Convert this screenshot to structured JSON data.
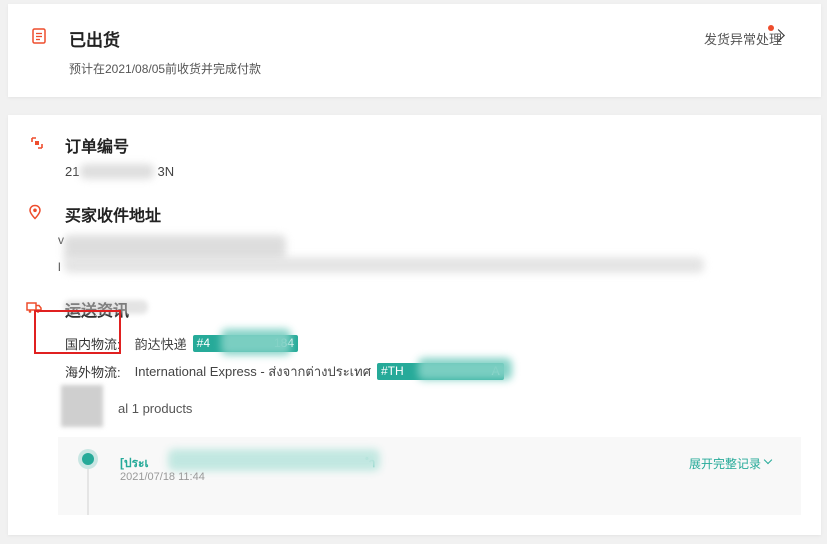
{
  "status": {
    "title": "已出货",
    "subtitle": "预计在2021/08/05前收货并完成付款",
    "exception_link": "发货异常处理",
    "icon": "document-icon"
  },
  "order": {
    "title": "订单编号",
    "number_prefix": "21",
    "number_suffix": "3N",
    "icon": "order-icon"
  },
  "address": {
    "title": "买家收件地址",
    "line1_prefix": "v",
    "line2_prefix": "l",
    "icon": "location-pin-icon"
  },
  "shipping": {
    "title": "运送资讯",
    "icon": "truck-icon",
    "domestic_label": "国内物流:",
    "domestic_carrier": "韵达快递",
    "domestic_tag_prefix": "#4",
    "domestic_tag_suffix": "184",
    "overseas_label": "海外物流:",
    "overseas_carrier": "International Express - ส่งจากต่างประเทศ",
    "overseas_tag_prefix": "#TH",
    "overseas_tag_suffix": "A"
  },
  "products": {
    "summary_fragment": "al 1 products"
  },
  "timeline": {
    "status_prefix": "[ประเ",
    "status_suffix": "ำ",
    "timestamp": "2021/07/18 11:44",
    "expand_label": "展开完整记录"
  },
  "colors": {
    "accent": "#26aa99",
    "brand_red": "#ee4d2d",
    "highlight_box": "#e02020"
  }
}
